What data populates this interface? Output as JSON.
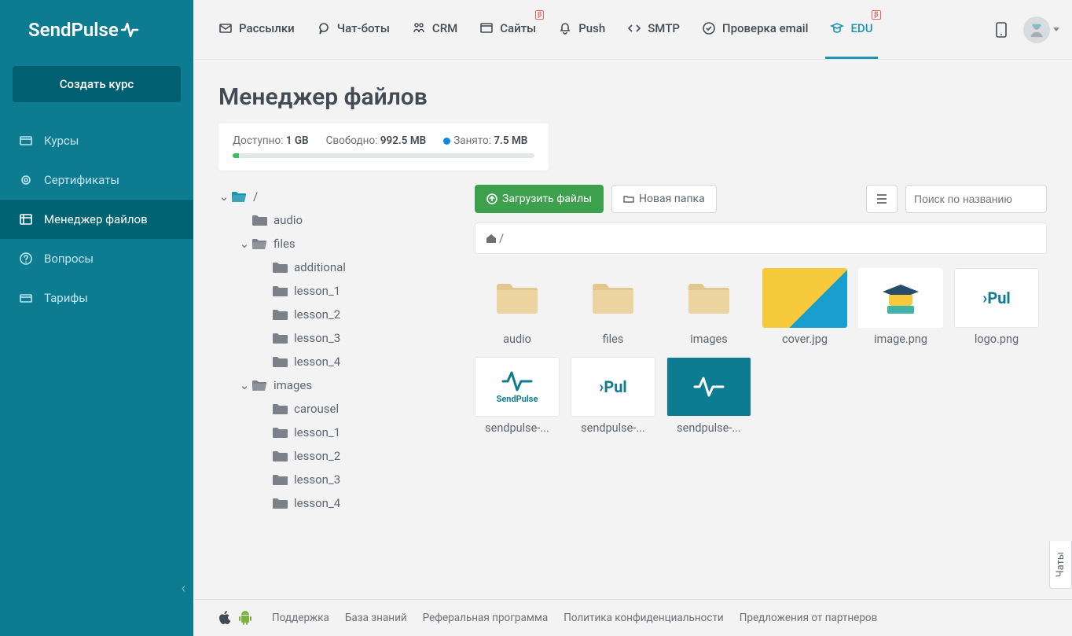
{
  "brand": "SendPulse",
  "sidebar": {
    "create_label": "Создать курс",
    "items": [
      {
        "label": "Курсы"
      },
      {
        "label": "Сертификаты"
      },
      {
        "label": "Менеджер файлов"
      },
      {
        "label": "Вопросы"
      },
      {
        "label": "Тарифы"
      }
    ]
  },
  "topnav": {
    "items": [
      {
        "label": "Рассылки"
      },
      {
        "label": "Чат-боты"
      },
      {
        "label": "CRM"
      },
      {
        "label": "Сайты",
        "beta": "β"
      },
      {
        "label": "Push"
      },
      {
        "label": "SMTP"
      },
      {
        "label": "Проверка email"
      },
      {
        "label": "EDU",
        "beta": "β"
      }
    ]
  },
  "page": {
    "title": "Менеджер файлов"
  },
  "storage": {
    "available_label": "Доступно:",
    "available_value": "1 GB",
    "free_label": "Свободно:",
    "free_value": "992.5 MB",
    "used_label": "Занято:",
    "used_value": "7.5 MB"
  },
  "tree": [
    {
      "label": "/",
      "level": 0,
      "caret": "down",
      "open": true
    },
    {
      "label": "audio",
      "level": 1,
      "closed": true
    },
    {
      "label": "files",
      "level": 1,
      "caret": "down"
    },
    {
      "label": "additional",
      "level": 2,
      "closed": true
    },
    {
      "label": "lesson_1",
      "level": 2,
      "closed": true
    },
    {
      "label": "lesson_2",
      "level": 2,
      "closed": true
    },
    {
      "label": "lesson_3",
      "level": 2,
      "closed": true
    },
    {
      "label": "lesson_4",
      "level": 2,
      "closed": true
    },
    {
      "label": "images",
      "level": 1,
      "caret": "down"
    },
    {
      "label": "carousel",
      "level": 2,
      "closed": true
    },
    {
      "label": "lesson_1",
      "level": 2,
      "closed": true
    },
    {
      "label": "lesson_2",
      "level": 2,
      "closed": true
    },
    {
      "label": "lesson_3",
      "level": 2,
      "closed": true
    },
    {
      "label": "lesson_4",
      "level": 2,
      "closed": true
    }
  ],
  "toolbar": {
    "upload_label": "Загрузить файлы",
    "newfolder_label": "Новая папка",
    "search_placeholder": "Поиск по названию"
  },
  "breadcrumb": {
    "path": "/"
  },
  "files": [
    {
      "name": "audio",
      "type": "folder"
    },
    {
      "name": "files",
      "type": "folder"
    },
    {
      "name": "images",
      "type": "folder"
    },
    {
      "name": "cover.jpg",
      "type": "img1"
    },
    {
      "name": "image.png",
      "type": "img2"
    },
    {
      "name": "logo.png",
      "type": "img3"
    },
    {
      "name": "sendpulse-...",
      "type": "sp1"
    },
    {
      "name": "sendpulse-...",
      "type": "sp2"
    },
    {
      "name": "sendpulse-...",
      "type": "sp3"
    }
  ],
  "footer": {
    "links": [
      "Поддержка",
      "База знаний",
      "Реферальная программа",
      "Политика конфиденциальности",
      "Предложения от партнеров"
    ]
  },
  "chat_tab": "Чаты"
}
